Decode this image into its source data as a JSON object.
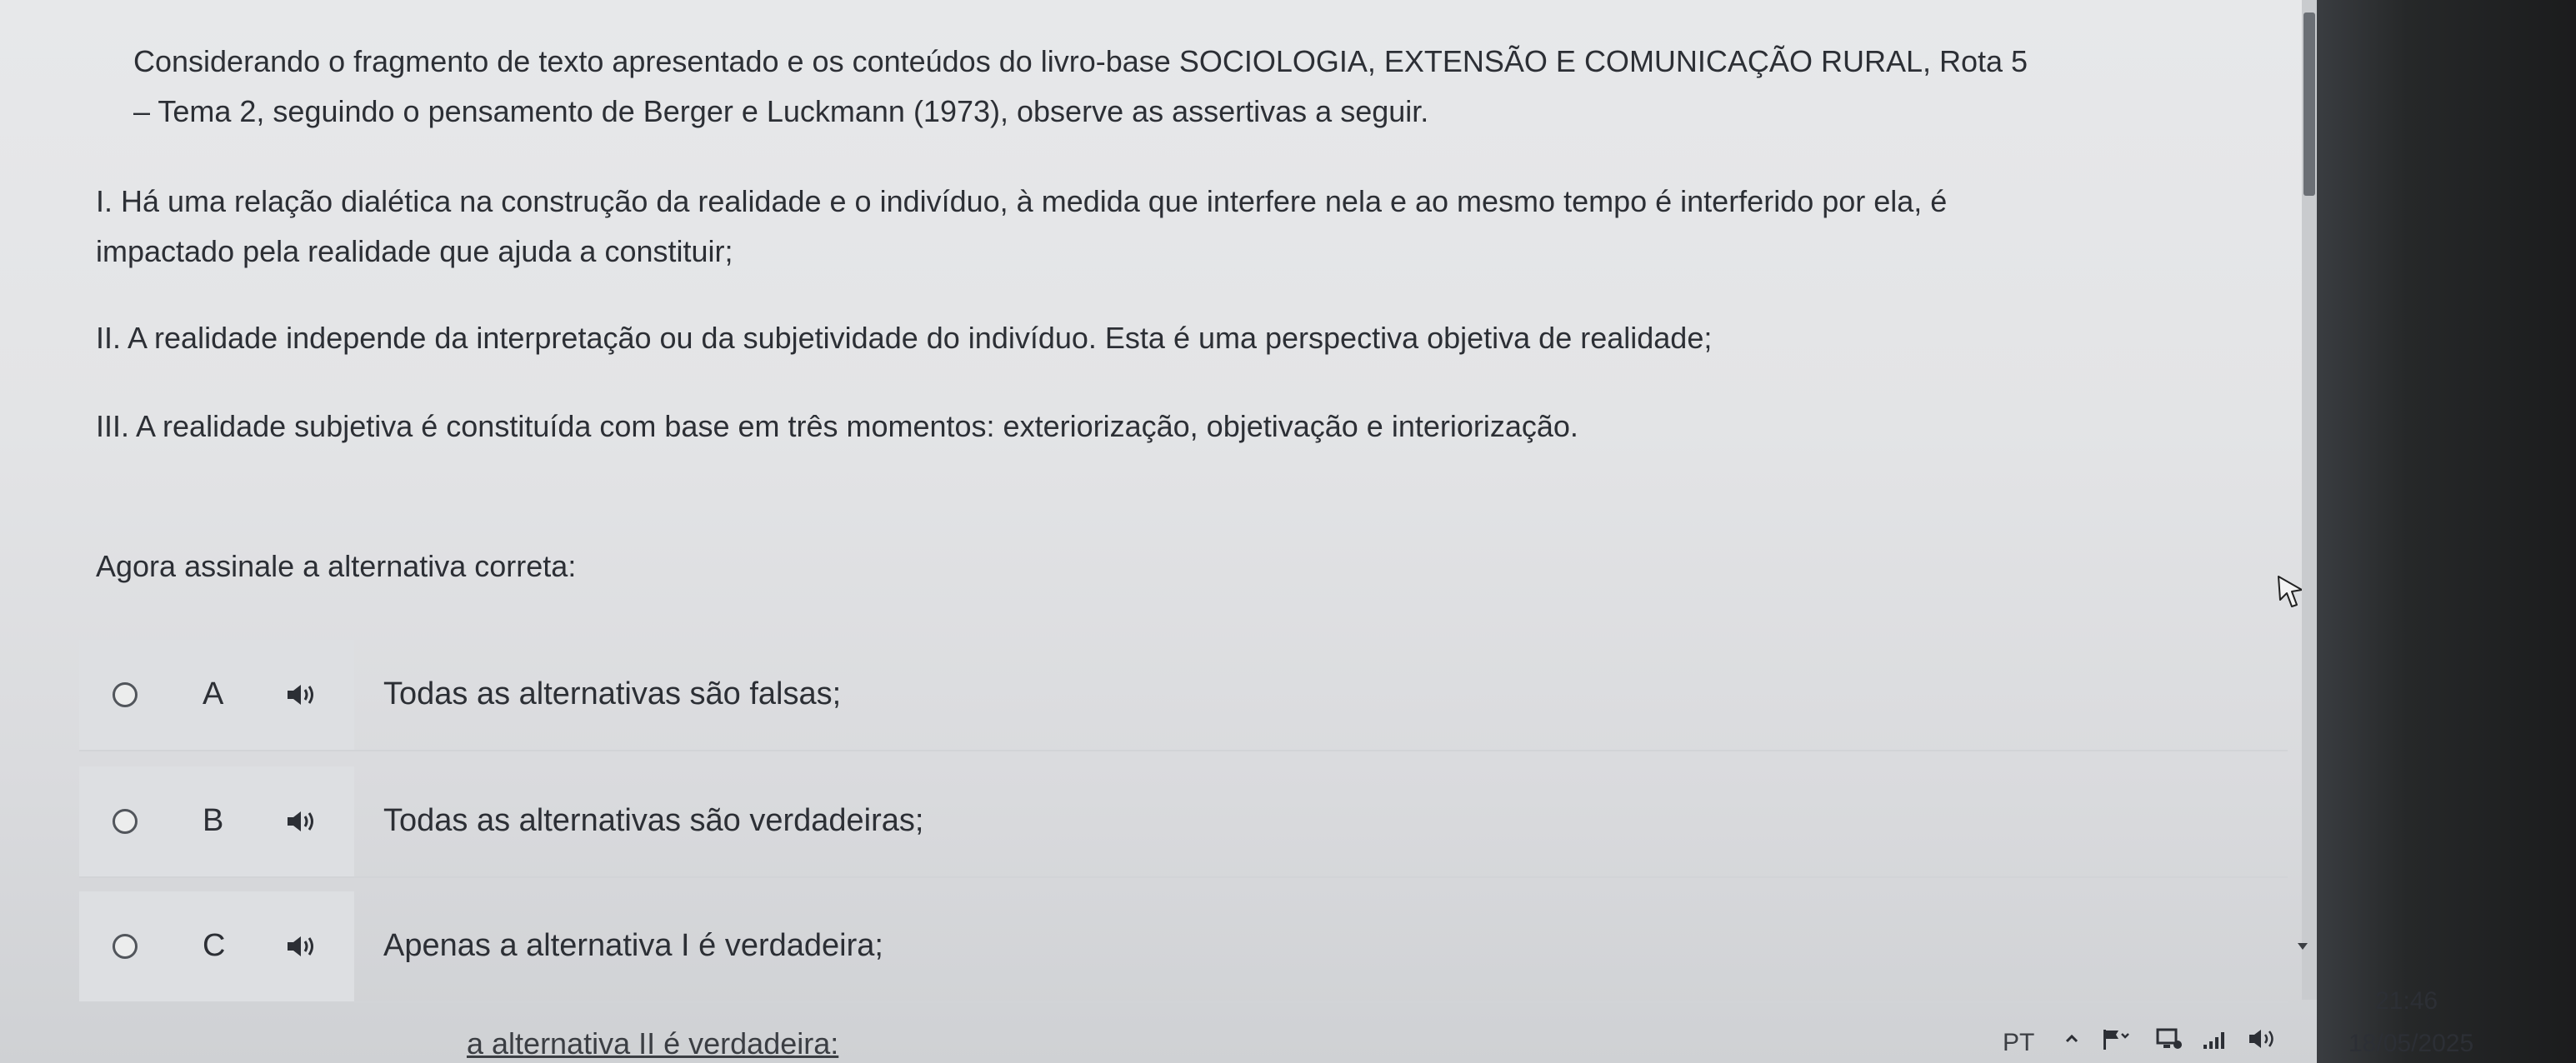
{
  "question": {
    "intro_line_1": "Considerando o fragmento de texto apresentado e os conteúdos do livro-base SOCIOLOGIA, EXTENSÃO E COMUNICAÇÃO RURAL, Rota 5",
    "intro_line_2": "– Tema 2, seguindo o pensamento de Berger e Luckmann (1973), observe as assertivas a seguir.",
    "assertion_1_line_1": "I. Há uma relação dialética na construção da realidade e o indivíduo, à medida que interfere nela e ao mesmo tempo é interferido por ela, é",
    "assertion_1_line_2": "impactado pela realidade que ajuda a constituir;",
    "assertion_2": "II. A realidade independe da interpretação ou da subjetividade do indivíduo. Esta é uma perspectiva objetiva de realidade;",
    "assertion_3": "III. A realidade subjetiva é constituída com base em três momentos: exteriorização, objetivação e interiorização.",
    "prompt": "Agora assinale a alternativa correta:"
  },
  "options": [
    {
      "letter": "A",
      "text": "Todas as alternativas são falsas;"
    },
    {
      "letter": "B",
      "text": "Todas as alternativas são verdadeiras;"
    },
    {
      "letter": "C",
      "text": "Apenas a alternativa I é verdadeira;"
    }
  ],
  "option_d_partial": "a alternativa II é verdadeira:",
  "taskbar": {
    "language": "PT",
    "time": "21:46",
    "date": "18/05/2025"
  },
  "icons": {
    "speaker": "speaker-icon",
    "cursor": "mouse-cursor-icon"
  }
}
